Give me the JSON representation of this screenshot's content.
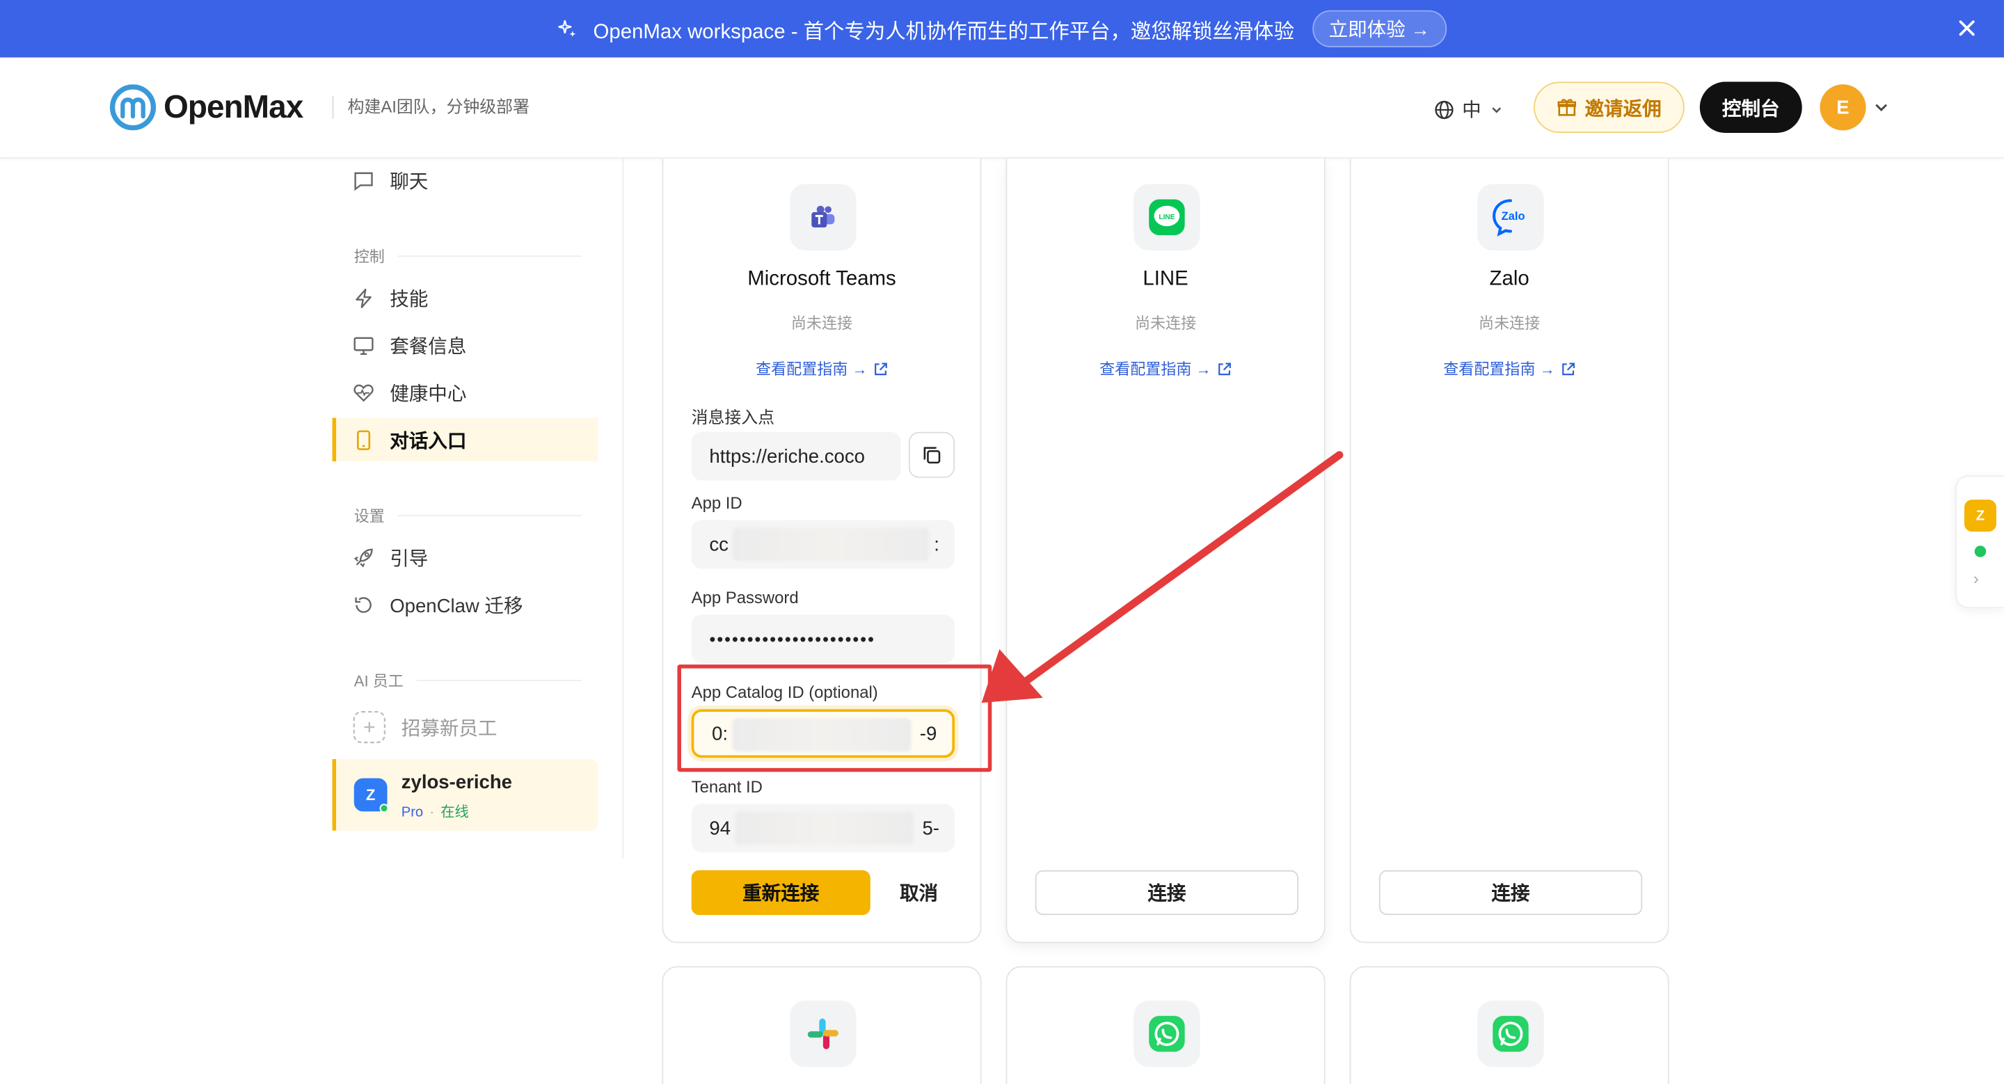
{
  "banner": {
    "text": "OpenMax workspace - 首个专为人机协作而生的工作平台，邀您解锁丝滑体验",
    "cta": "立即体验 →"
  },
  "header": {
    "brand": "OpenMax",
    "tagline": "构建AI团队，分钟级部署",
    "language": "中",
    "invite": "邀请返佣",
    "console": "控制台",
    "avatar_letter": "E"
  },
  "sidebar": {
    "chat": "聊天",
    "section_control": "控制",
    "skills": "技能",
    "plan": "套餐信息",
    "health": "健康中心",
    "entry": "对话入口",
    "section_settings": "设置",
    "guide": "引导",
    "migrate": "OpenClaw 迁移",
    "section_ai": "AI 员工",
    "recruit": "招募新员工",
    "agent": {
      "name": "zylos-eriche",
      "plan": "Pro",
      "separator": "·",
      "status": "在线",
      "avatar_letter": "Z"
    }
  },
  "cards": {
    "teams": {
      "title": "Microsoft Teams",
      "status": "尚未连接",
      "guide": "查看配置指南 →",
      "endpoint_label": "消息接入点",
      "endpoint_value": "https://eriche.coco",
      "appid_label": "App ID",
      "appid_prefix": "cc",
      "appid_suffix": ":",
      "password_label": "App Password",
      "password_value": "••••••••••••••••••••••",
      "catalog_label": "App Catalog ID (optional)",
      "catalog_prefix": "0:",
      "catalog_suffix": "-9",
      "tenant_label": "Tenant ID",
      "tenant_prefix": "94",
      "tenant_suffix": "5-",
      "reconnect": "重新连接",
      "cancel": "取消"
    },
    "line": {
      "title": "LINE",
      "status": "尚未连接",
      "guide": "查看配置指南 →",
      "connect": "连接",
      "icon_text": "LINE"
    },
    "zalo": {
      "title": "Zalo",
      "status": "尚未连接",
      "guide": "查看配置指南 →",
      "connect": "连接",
      "icon_text": "Zalo"
    }
  },
  "float_panel": {
    "badge": "Z",
    "chevron": "›"
  },
  "colors": {
    "banner": "#3a63e8",
    "accent": "#f5b400",
    "annotation": "#e43c3c",
    "link": "#2f5fd8",
    "online": "#22c55e"
  }
}
